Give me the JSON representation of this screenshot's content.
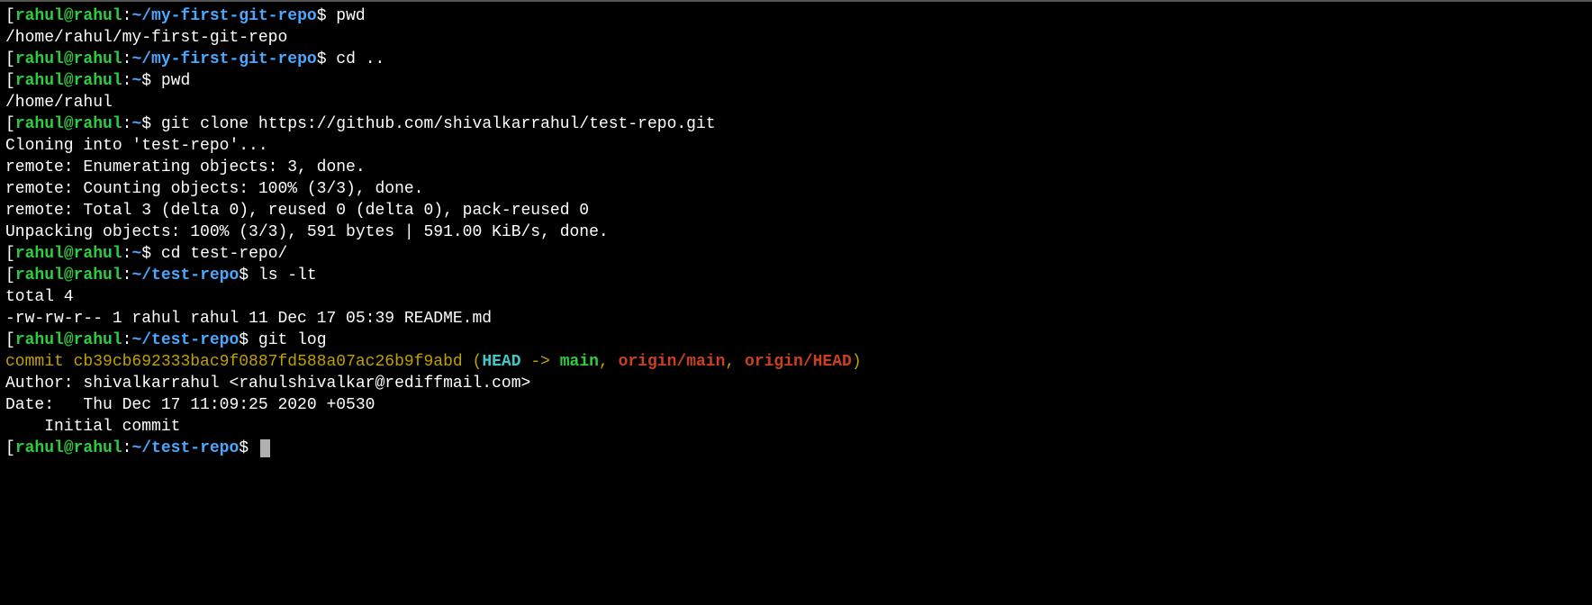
{
  "prompts": [
    {
      "userhost": "rahul@rahul",
      "path": "~/my-first-git-repo",
      "cmd": "pwd"
    },
    {
      "userhost": "rahul@rahul",
      "path": "~/my-first-git-repo",
      "cmd": "cd .."
    },
    {
      "userhost": "rahul@rahul",
      "path": "~",
      "cmd": "pwd"
    },
    {
      "userhost": "rahul@rahul",
      "path": "~",
      "cmd": "git clone https://github.com/shivalkarrahul/test-repo.git"
    },
    {
      "userhost": "rahul@rahul",
      "path": "~",
      "cmd": "cd test-repo/"
    },
    {
      "userhost": "rahul@rahul",
      "path": "~/test-repo",
      "cmd": "ls -lt"
    },
    {
      "userhost": "rahul@rahul",
      "path": "~/test-repo",
      "cmd": "git log"
    },
    {
      "userhost": "rahul@rahul",
      "path": "~/test-repo",
      "cmd": ""
    }
  ],
  "outputs": {
    "pwd1": "/home/rahul/my-first-git-repo",
    "pwd2": "/home/rahul",
    "clone_into": "Cloning into 'test-repo'...",
    "enum": "remote: Enumerating objects: 3, done.",
    "count": "remote: Counting objects: 100% (3/3), done.",
    "total": "remote: Total 3 (delta 0), reused 0 (delta 0), pack-reused 0",
    "unpack": "Unpacking objects: 100% (3/3), 591 bytes | 591.00 KiB/s, done.",
    "ls_total": "total 4",
    "ls_readme": "-rw-rw-r-- 1 rahul rahul 11 Dec 17 05:39 README.md",
    "author": "Author: shivalkarrahul <rahulshivalkar@rediffmail.com>",
    "date": "Date:   Thu Dec 17 11:09:25 2020 +0530",
    "commit_msg": "    Initial commit",
    "blank": ""
  },
  "git": {
    "commit_word": "commit ",
    "hash": "cb39cb692333bac9f0887fd588a07ac26b9f9abd",
    "open_paren": " (",
    "head": "HEAD",
    "arrow": " -> ",
    "main": "main",
    "sep": ", ",
    "origin_main": "origin/main",
    "origin_head": "origin/HEAD",
    "close_paren": ")"
  },
  "sym": {
    "open_bracket": "[",
    "colon": ":",
    "dollar_suffix": "$ "
  }
}
